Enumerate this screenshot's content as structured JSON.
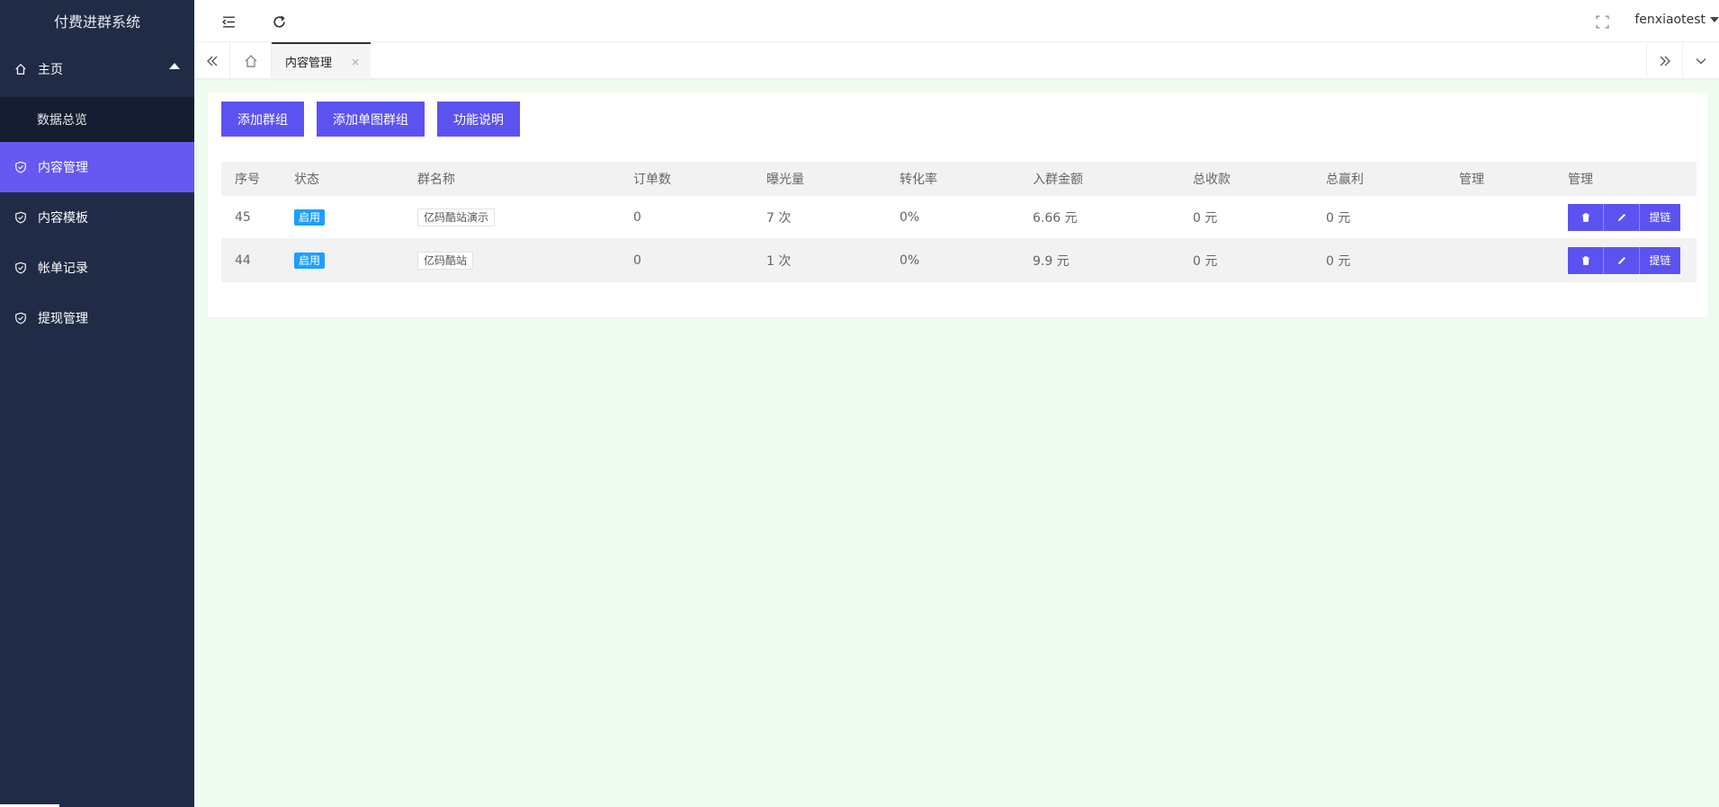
{
  "sidebar": {
    "title": "付费进群系统",
    "home": {
      "label": "主页",
      "icon": "home-icon"
    },
    "home_sub": [
      {
        "label": "数据总览"
      }
    ],
    "items": [
      {
        "label": "内容管理",
        "icon": "shield-icon",
        "active": true
      },
      {
        "label": "内容模板",
        "icon": "shield-icon"
      },
      {
        "label": "帐单记录",
        "icon": "shield-icon"
      },
      {
        "label": "提现管理",
        "icon": "shield-icon"
      }
    ],
    "active_color": "#6758f2"
  },
  "header": {
    "icons": [
      "menu-fold-icon",
      "refresh-icon",
      "fullscreen-icon"
    ],
    "user": "fenxiaotest"
  },
  "tabs": {
    "active": {
      "label": "内容管理",
      "close": "×"
    }
  },
  "toolbar": {
    "add_group": "添加群组",
    "add_single_group": "添加单图群组",
    "help": "功能说明"
  },
  "table": {
    "columns": [
      "序号",
      "状态",
      "群名称",
      "订单数",
      "曝光量",
      "转化率",
      "入群金额",
      "总收款",
      "总赢利",
      "管理",
      "管理"
    ],
    "rows": [
      {
        "id": "45",
        "status": "启用",
        "name": "亿码酷站演示",
        "orders": "0",
        "views": "7 次",
        "rate": "0%",
        "amount": "6.66 元",
        "total_income": "0 元",
        "total_profit": "0 元",
        "manage": "",
        "link_label": "提链"
      },
      {
        "id": "44",
        "status": "启用",
        "name": "亿码酷站",
        "orders": "0",
        "views": "1 次",
        "rate": "0%",
        "amount": "9.9 元",
        "total_income": "0 元",
        "total_profit": "0 元",
        "manage": "",
        "link_label": "提链"
      }
    ]
  },
  "colors": {
    "primary": "#5c52f0",
    "badge": "#1e9fff",
    "sidebar_bg": "#202b46",
    "page_bg": "#f0fcf0"
  }
}
